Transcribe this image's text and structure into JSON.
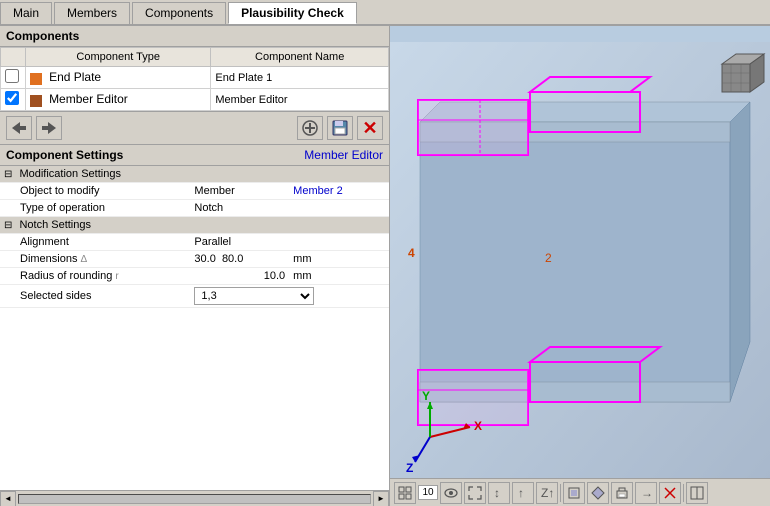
{
  "tabs": [
    {
      "label": "Main",
      "active": false
    },
    {
      "label": "Members",
      "active": false
    },
    {
      "label": "Components",
      "active": false
    },
    {
      "label": "Plausibility Check",
      "active": true
    }
  ],
  "left_panel": {
    "components_section": {
      "title": "Components",
      "col_type": "Component Type",
      "col_name": "Component Name",
      "rows": [
        {
          "checked": false,
          "color": "orange",
          "type": "End Plate",
          "name": "End Plate 1"
        },
        {
          "checked": true,
          "color": "brown",
          "type": "Member Editor",
          "name": "Member Editor"
        }
      ]
    },
    "toolbar": {
      "btn_move_left": "◄",
      "btn_move_right": "►",
      "btn_add": "➕",
      "btn_save": "💾",
      "btn_delete": "✕"
    },
    "settings": {
      "title": "Component Settings",
      "subtitle": "Member Editor",
      "sections": [
        {
          "label": "Modification Settings",
          "rows": [
            {
              "label": "Object to modify",
              "value": "Member",
              "value2": "Member 2"
            },
            {
              "label": "Type of operation",
              "value": "Notch",
              "value2": ""
            }
          ]
        },
        {
          "label": "Notch Settings",
          "rows": [
            {
              "label": "Alignment",
              "symbol": "",
              "value": "Parallel",
              "value2": "",
              "unit": ""
            },
            {
              "label": "Dimensions",
              "symbol": "Δ",
              "value": "30.0",
              "value2": "80.0",
              "unit": "mm"
            },
            {
              "label": "Radius of rounding",
              "symbol": "r",
              "value": "10.0",
              "value2": "",
              "unit": "mm"
            },
            {
              "label": "Selected sides",
              "symbol": "",
              "value": "1,3",
              "value2": "",
              "unit": "",
              "dropdown": true
            }
          ]
        }
      ]
    }
  },
  "view_toolbar": {
    "buttons": [
      "⊞",
      "10",
      "👁",
      "↔",
      "↕",
      "↑",
      "⊥",
      "Z↑",
      "□",
      "⬡",
      "🖨",
      "→",
      "✕",
      "⊟"
    ]
  }
}
